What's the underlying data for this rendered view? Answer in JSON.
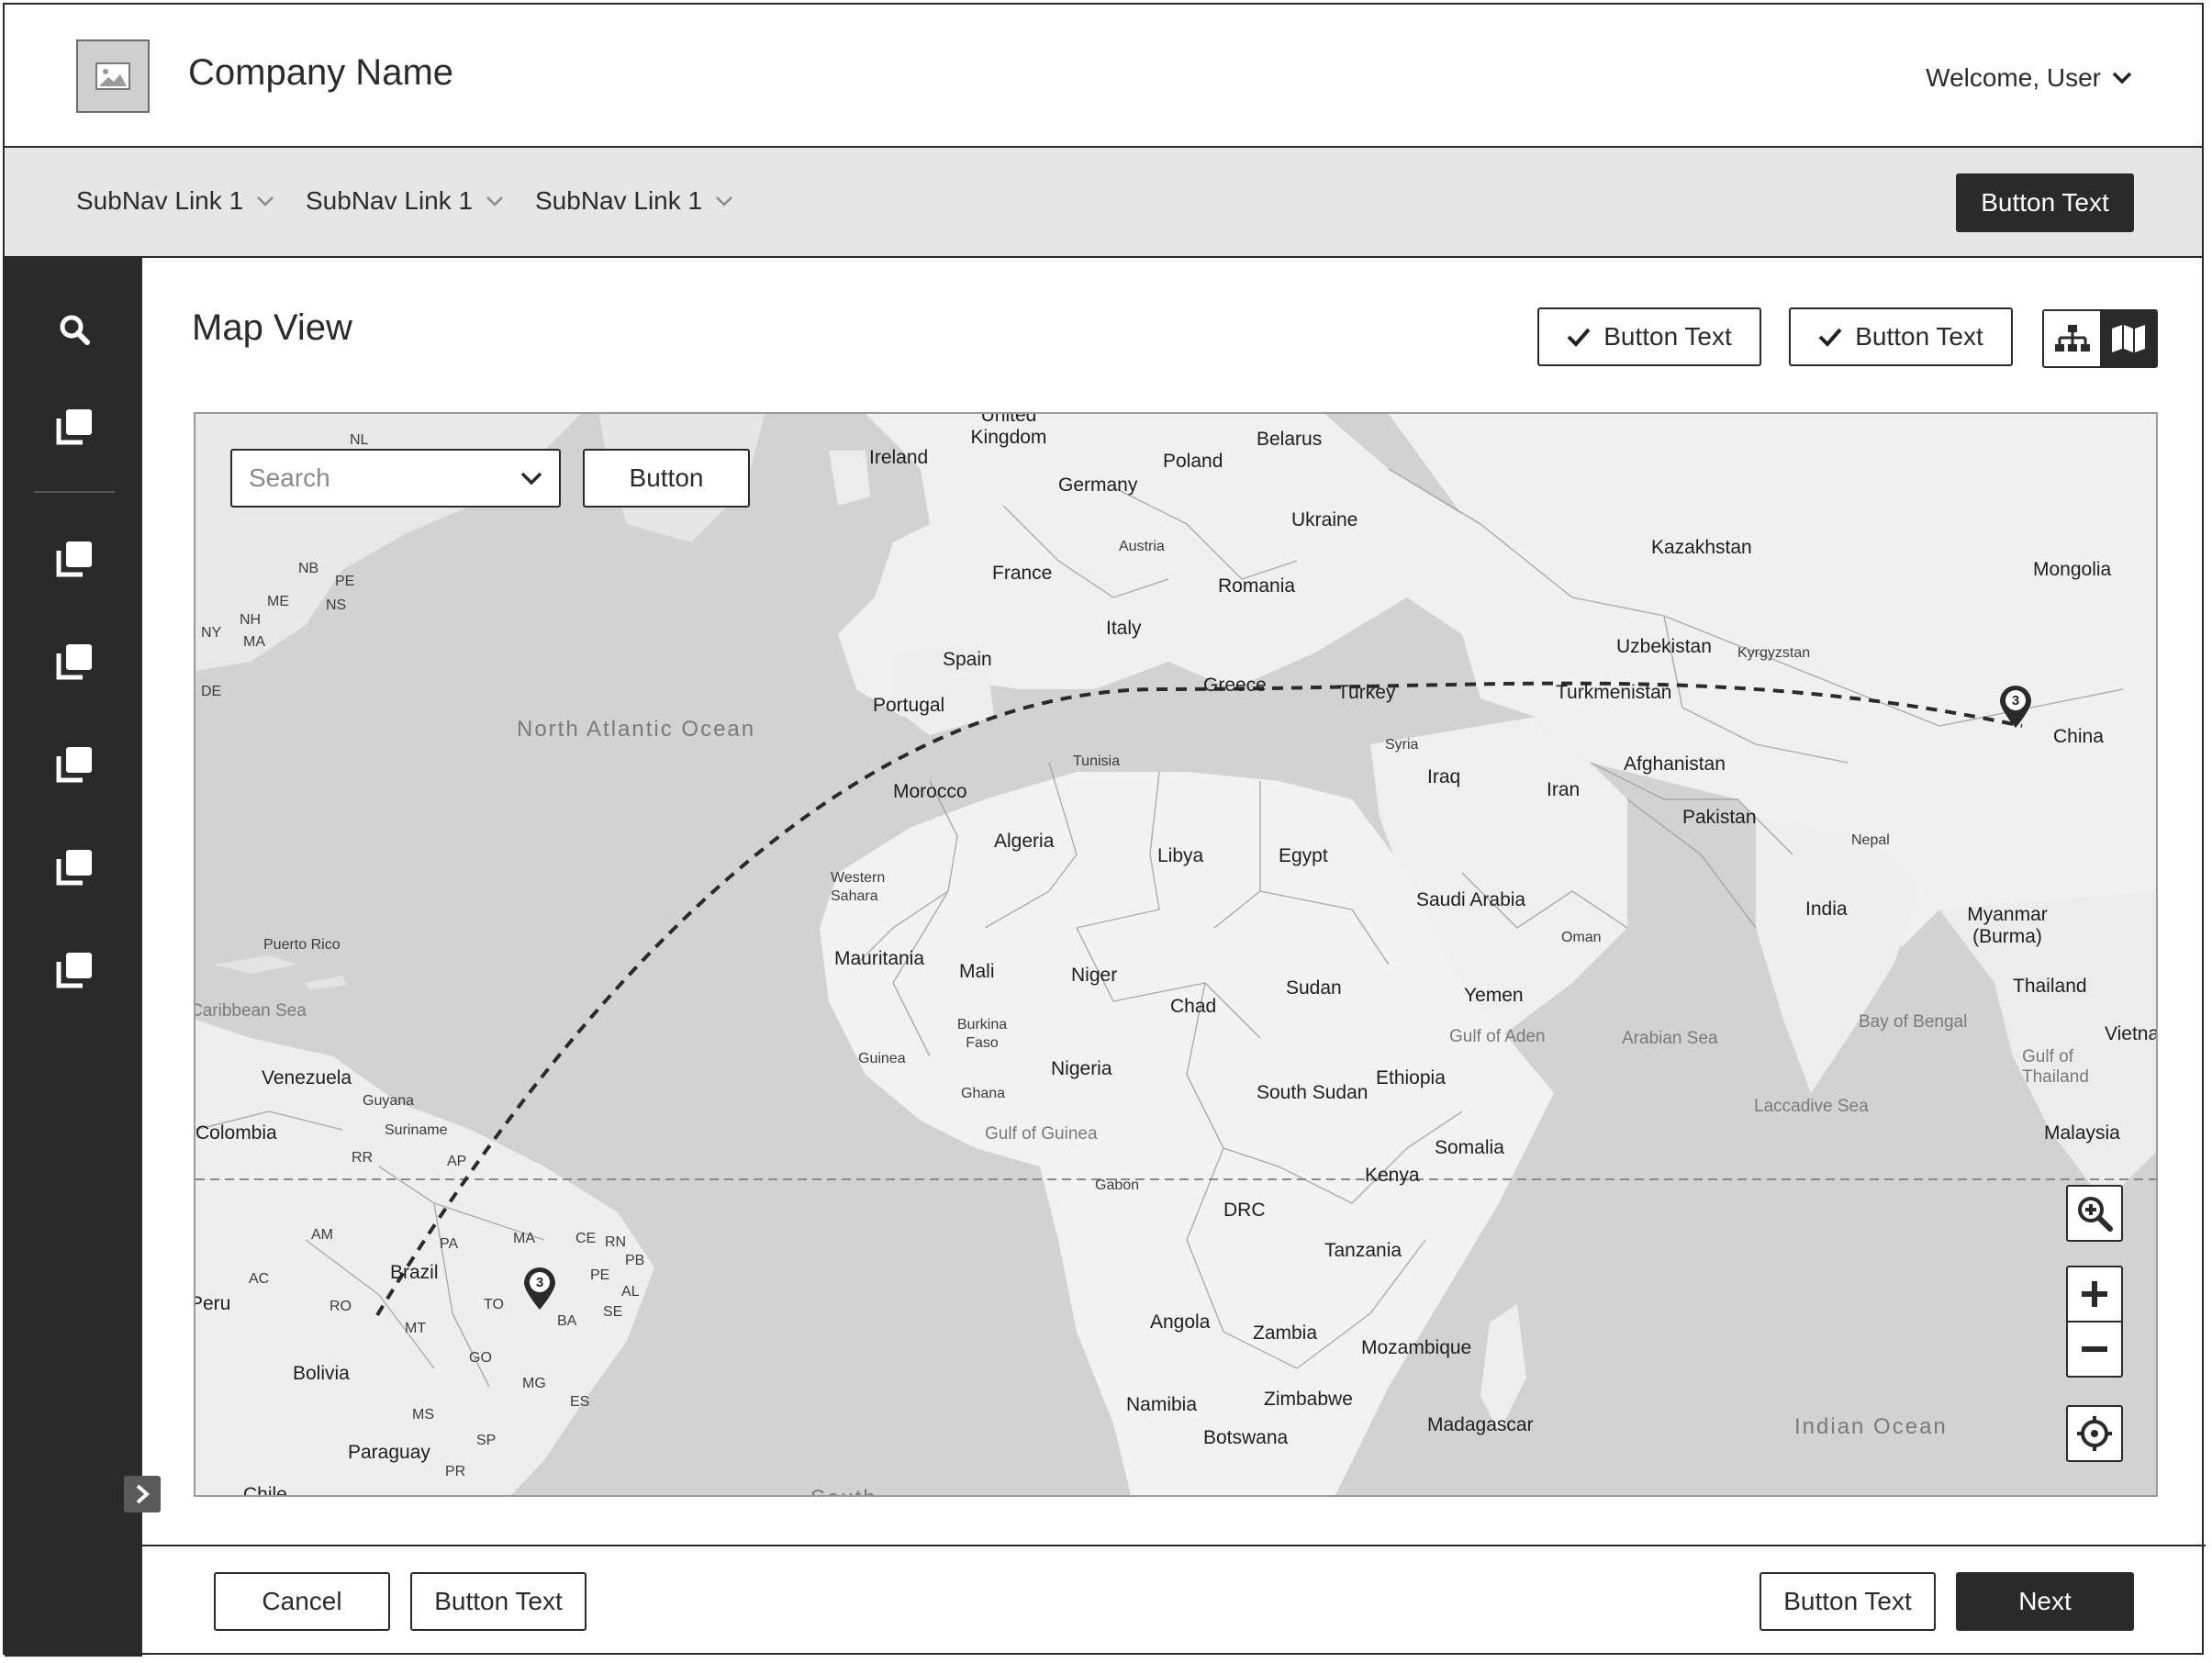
{
  "header": {
    "company_name": "Company Name",
    "welcome": "Welcome, User"
  },
  "subnav": {
    "links": [
      "SubNav Link 1",
      "SubNav Link 1",
      "SubNav Link 1"
    ],
    "action_button": "Button Text"
  },
  "sidebar": {
    "icons": [
      "search-icon",
      "copy-icon",
      "copy-icon",
      "copy-icon",
      "copy-icon",
      "copy-icon",
      "copy-icon"
    ]
  },
  "main": {
    "title": "Map View",
    "toolbar": {
      "check_button_1": "Button Text",
      "check_button_2": "Button Text",
      "view_toggle": [
        "hierarchy-icon",
        "map-icon"
      ],
      "active_view": "map"
    }
  },
  "map": {
    "search_placeholder": "Search",
    "search_button": "Button",
    "pins": [
      {
        "count": "3"
      },
      {
        "count": "3"
      }
    ],
    "labels": {
      "countries": [
        "United Kingdom",
        "Ireland",
        "Belarus",
        "Poland",
        "Germany",
        "Ukraine",
        "Austria",
        "France",
        "Romania",
        "Kazakhstan",
        "Mongolia",
        "Italy",
        "Spain",
        "Portugal",
        "Greece",
        "Turkey",
        "Uzbekistan",
        "Kyrgyzstan",
        "Turkmenistan",
        "China",
        "Tunisia",
        "Syria",
        "Iraq",
        "Iran",
        "Afghanistan",
        "Pakistan",
        "Morocco",
        "Algeria",
        "Libya",
        "Egypt",
        "Western Sahara",
        "Saudi Arabia",
        "Nepal",
        "India",
        "Oman",
        "Myanmar (Burma)",
        "Mauritania",
        "Mali",
        "Niger",
        "Chad",
        "Sudan",
        "Yemen",
        "Thailand",
        "Vietnam",
        "Burkina Faso",
        "Guinea",
        "Ghana",
        "Nigeria",
        "Ethiopia",
        "South Sudan",
        "Somalia",
        "Malaysia",
        "Venezuela",
        "Guyana",
        "Suriname",
        "Colombia",
        "Gabon",
        "Kenya",
        "DRC",
        "Tanzania",
        "Brazil",
        "Peru",
        "Angola",
        "Zambia",
        "Mozambique",
        "Bolivia",
        "Zimbabwe",
        "Namibia",
        "Madagascar",
        "Botswana",
        "Paraguay",
        "Chile",
        "Puerto Rico"
      ],
      "states": [
        "NL",
        "NB",
        "PE",
        "ME",
        "NS",
        "NH",
        "NY",
        "MA",
        "DE",
        "RR",
        "AP",
        "AM",
        "PA",
        "MA",
        "CE",
        "RN",
        "PB",
        "PE",
        "AL",
        "SE",
        "AC",
        "RO",
        "TO",
        "MT",
        "BA",
        "GO",
        "MG",
        "ES",
        "MS",
        "SP",
        "PR"
      ],
      "water": [
        "Caribbean Sea",
        "Gulf of Aden",
        "Arabian Sea",
        "Bay of Bengal",
        "Gulf of Thailand",
        "Laccadive Sea",
        "Gulf of Guinea"
      ],
      "oceans": [
        "North Atlantic Ocean",
        "Indian Ocean",
        "South"
      ]
    },
    "controls": [
      "zoom-search-icon",
      "plus-icon",
      "minus-icon",
      "locate-icon"
    ]
  },
  "footer": {
    "cancel": "Cancel",
    "secondary_left": "Button Text",
    "secondary_right": "Button Text",
    "next": "Next"
  },
  "colors": {
    "dark": "#2a2a2a",
    "subnav_bg": "#e6e6e6",
    "map_water": "#d2d2d2",
    "map_land": "#f0f0f0"
  }
}
